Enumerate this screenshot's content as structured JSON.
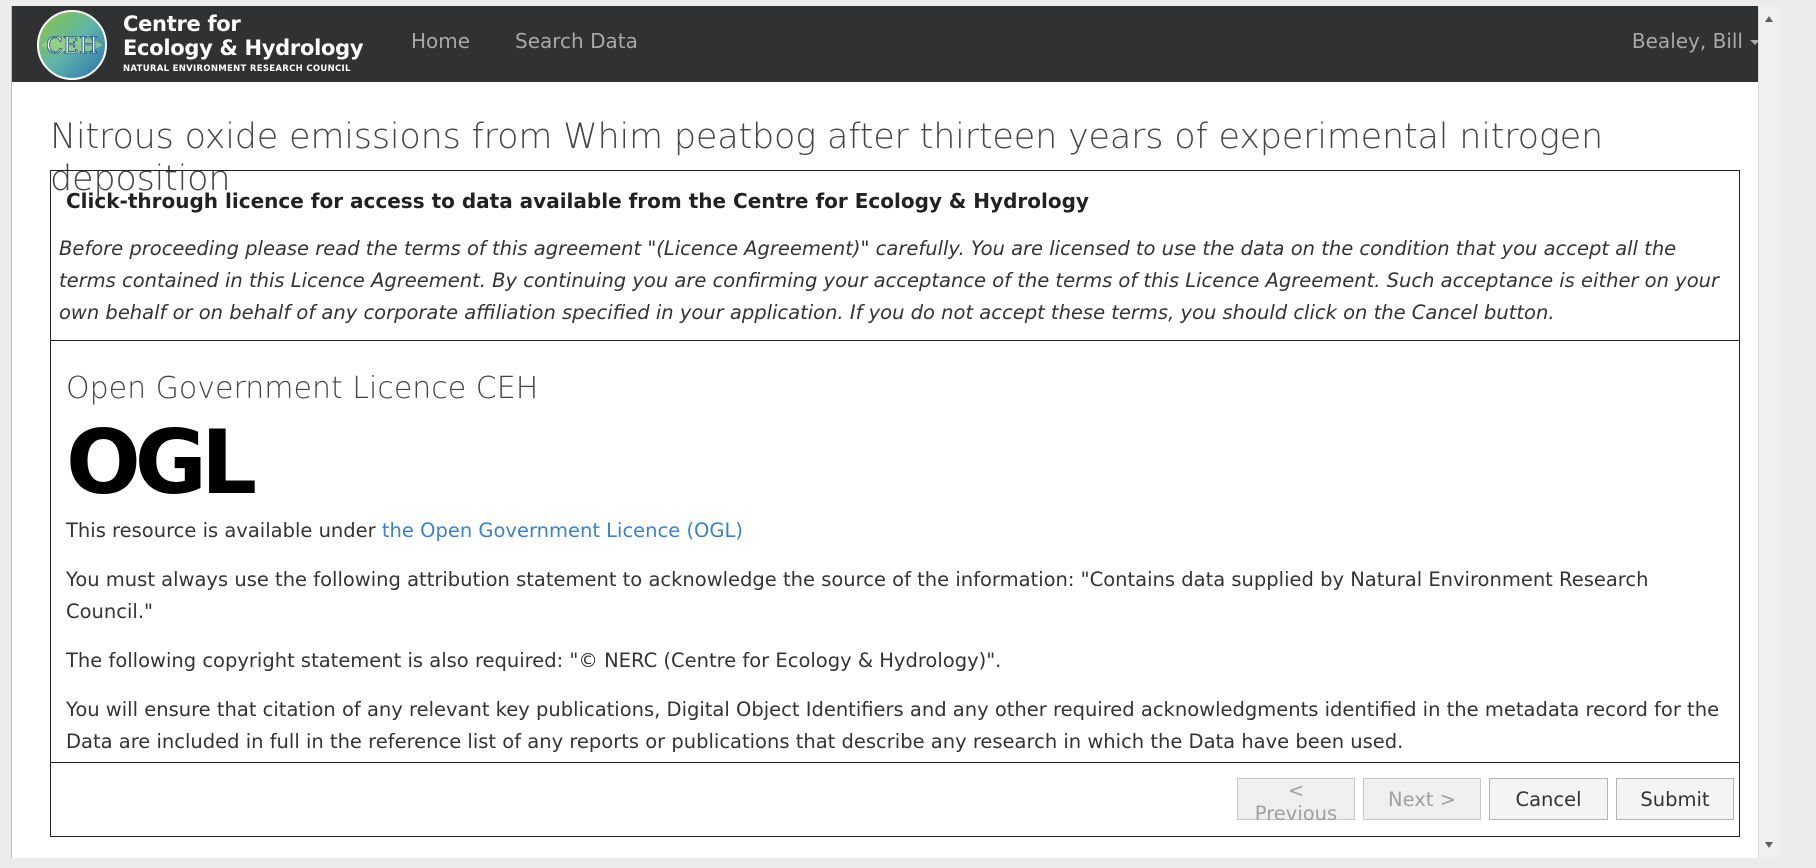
{
  "navbar": {
    "brand_line1": "Centre for",
    "brand_line2": "Ecology & Hydrology",
    "brand_sub": "NATURAL ENVIRONMENT RESEARCH COUNCIL",
    "logo_text": "CEH",
    "home_label": "Home",
    "search_label": "Search Data",
    "user_label": "Bealey, Bill"
  },
  "page": {
    "title": "Nitrous oxide emissions from Whim peatbog after thirteen years of experimental nitrogen deposition"
  },
  "licence": {
    "header_title": "Click-through licence for access to data available from the Centre for Ecology & Hydrology",
    "intro_text": "Before proceeding please read the terms of this agreement \"(Licence Agreement)\" carefully. You are licensed to use the data on the condition that you accept all the terms contained in this Licence Agreement. By continuing you are confirming your acceptance of the terms of this Licence Agreement. Such acceptance is either on your own behalf or on behalf of any corporate affiliation specified in your application. If you do not accept these terms, you should click on the Cancel button.",
    "name": "Open Government Licence CEH",
    "logo_text": "OGL",
    "available_prefix": "This resource is available under ",
    "available_link": "the Open Government Licence (OGL)",
    "attribution": "You must always use the following attribution statement to acknowledge the source of the information: \"Contains data supplied by Natural Environment Research Council.\"",
    "copyright": "The following copyright statement is also required: \"© NERC (Centre for Ecology & Hydrology)\".",
    "citation": "You will ensure that citation of any relevant key publications, Digital Object Identifiers and any other required acknowledgments identified in the metadata record for the Data are included in full in the reference list of any reports or publications that describe any research in which the Data have been used."
  },
  "buttons": {
    "previous": "< Previous",
    "next": "Next >",
    "cancel": "Cancel",
    "submit": "Submit"
  },
  "colors": {
    "navbar_bg": "#2f3133",
    "link": "#3b82c8",
    "logo_blue": "#2a6fb0",
    "logo_green": "#8cc63f"
  }
}
